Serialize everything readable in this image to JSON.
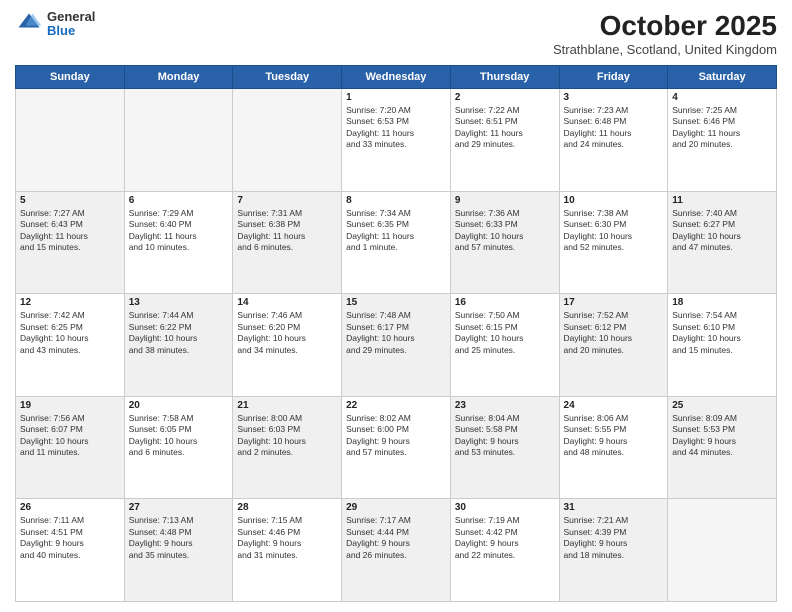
{
  "header": {
    "logo_general": "General",
    "logo_blue": "Blue",
    "month_title": "October 2025",
    "subtitle": "Strathblane, Scotland, United Kingdom"
  },
  "days_of_week": [
    "Sunday",
    "Monday",
    "Tuesday",
    "Wednesday",
    "Thursday",
    "Friday",
    "Saturday"
  ],
  "weeks": [
    [
      {
        "day": "",
        "info": "",
        "empty": true
      },
      {
        "day": "",
        "info": "",
        "empty": true
      },
      {
        "day": "",
        "info": "",
        "empty": true
      },
      {
        "day": "1",
        "info": "Sunrise: 7:20 AM\nSunset: 6:53 PM\nDaylight: 11 hours\nand 33 minutes."
      },
      {
        "day": "2",
        "info": "Sunrise: 7:22 AM\nSunset: 6:51 PM\nDaylight: 11 hours\nand 29 minutes."
      },
      {
        "day": "3",
        "info": "Sunrise: 7:23 AM\nSunset: 6:48 PM\nDaylight: 11 hours\nand 24 minutes."
      },
      {
        "day": "4",
        "info": "Sunrise: 7:25 AM\nSunset: 6:46 PM\nDaylight: 11 hours\nand 20 minutes."
      }
    ],
    [
      {
        "day": "5",
        "info": "Sunrise: 7:27 AM\nSunset: 6:43 PM\nDaylight: 11 hours\nand 15 minutes.",
        "shaded": true
      },
      {
        "day": "6",
        "info": "Sunrise: 7:29 AM\nSunset: 6:40 PM\nDaylight: 11 hours\nand 10 minutes."
      },
      {
        "day": "7",
        "info": "Sunrise: 7:31 AM\nSunset: 6:38 PM\nDaylight: 11 hours\nand 6 minutes.",
        "shaded": true
      },
      {
        "day": "8",
        "info": "Sunrise: 7:34 AM\nSunset: 6:35 PM\nDaylight: 11 hours\nand 1 minute."
      },
      {
        "day": "9",
        "info": "Sunrise: 7:36 AM\nSunset: 6:33 PM\nDaylight: 10 hours\nand 57 minutes.",
        "shaded": true
      },
      {
        "day": "10",
        "info": "Sunrise: 7:38 AM\nSunset: 6:30 PM\nDaylight: 10 hours\nand 52 minutes."
      },
      {
        "day": "11",
        "info": "Sunrise: 7:40 AM\nSunset: 6:27 PM\nDaylight: 10 hours\nand 47 minutes.",
        "shaded": true
      }
    ],
    [
      {
        "day": "12",
        "info": "Sunrise: 7:42 AM\nSunset: 6:25 PM\nDaylight: 10 hours\nand 43 minutes."
      },
      {
        "day": "13",
        "info": "Sunrise: 7:44 AM\nSunset: 6:22 PM\nDaylight: 10 hours\nand 38 minutes.",
        "shaded": true
      },
      {
        "day": "14",
        "info": "Sunrise: 7:46 AM\nSunset: 6:20 PM\nDaylight: 10 hours\nand 34 minutes."
      },
      {
        "day": "15",
        "info": "Sunrise: 7:48 AM\nSunset: 6:17 PM\nDaylight: 10 hours\nand 29 minutes.",
        "shaded": true
      },
      {
        "day": "16",
        "info": "Sunrise: 7:50 AM\nSunset: 6:15 PM\nDaylight: 10 hours\nand 25 minutes."
      },
      {
        "day": "17",
        "info": "Sunrise: 7:52 AM\nSunset: 6:12 PM\nDaylight: 10 hours\nand 20 minutes.",
        "shaded": true
      },
      {
        "day": "18",
        "info": "Sunrise: 7:54 AM\nSunset: 6:10 PM\nDaylight: 10 hours\nand 15 minutes."
      }
    ],
    [
      {
        "day": "19",
        "info": "Sunrise: 7:56 AM\nSunset: 6:07 PM\nDaylight: 10 hours\nand 11 minutes.",
        "shaded": true
      },
      {
        "day": "20",
        "info": "Sunrise: 7:58 AM\nSunset: 6:05 PM\nDaylight: 10 hours\nand 6 minutes."
      },
      {
        "day": "21",
        "info": "Sunrise: 8:00 AM\nSunset: 6:03 PM\nDaylight: 10 hours\nand 2 minutes.",
        "shaded": true
      },
      {
        "day": "22",
        "info": "Sunrise: 8:02 AM\nSunset: 6:00 PM\nDaylight: 9 hours\nand 57 minutes."
      },
      {
        "day": "23",
        "info": "Sunrise: 8:04 AM\nSunset: 5:58 PM\nDaylight: 9 hours\nand 53 minutes.",
        "shaded": true
      },
      {
        "day": "24",
        "info": "Sunrise: 8:06 AM\nSunset: 5:55 PM\nDaylight: 9 hours\nand 48 minutes."
      },
      {
        "day": "25",
        "info": "Sunrise: 8:09 AM\nSunset: 5:53 PM\nDaylight: 9 hours\nand 44 minutes.",
        "shaded": true
      }
    ],
    [
      {
        "day": "26",
        "info": "Sunrise: 7:11 AM\nSunset: 4:51 PM\nDaylight: 9 hours\nand 40 minutes."
      },
      {
        "day": "27",
        "info": "Sunrise: 7:13 AM\nSunset: 4:48 PM\nDaylight: 9 hours\nand 35 minutes.",
        "shaded": true
      },
      {
        "day": "28",
        "info": "Sunrise: 7:15 AM\nSunset: 4:46 PM\nDaylight: 9 hours\nand 31 minutes."
      },
      {
        "day": "29",
        "info": "Sunrise: 7:17 AM\nSunset: 4:44 PM\nDaylight: 9 hours\nand 26 minutes.",
        "shaded": true
      },
      {
        "day": "30",
        "info": "Sunrise: 7:19 AM\nSunset: 4:42 PM\nDaylight: 9 hours\nand 22 minutes."
      },
      {
        "day": "31",
        "info": "Sunrise: 7:21 AM\nSunset: 4:39 PM\nDaylight: 9 hours\nand 18 minutes.",
        "shaded": true
      },
      {
        "day": "",
        "info": "",
        "empty": true
      }
    ]
  ]
}
